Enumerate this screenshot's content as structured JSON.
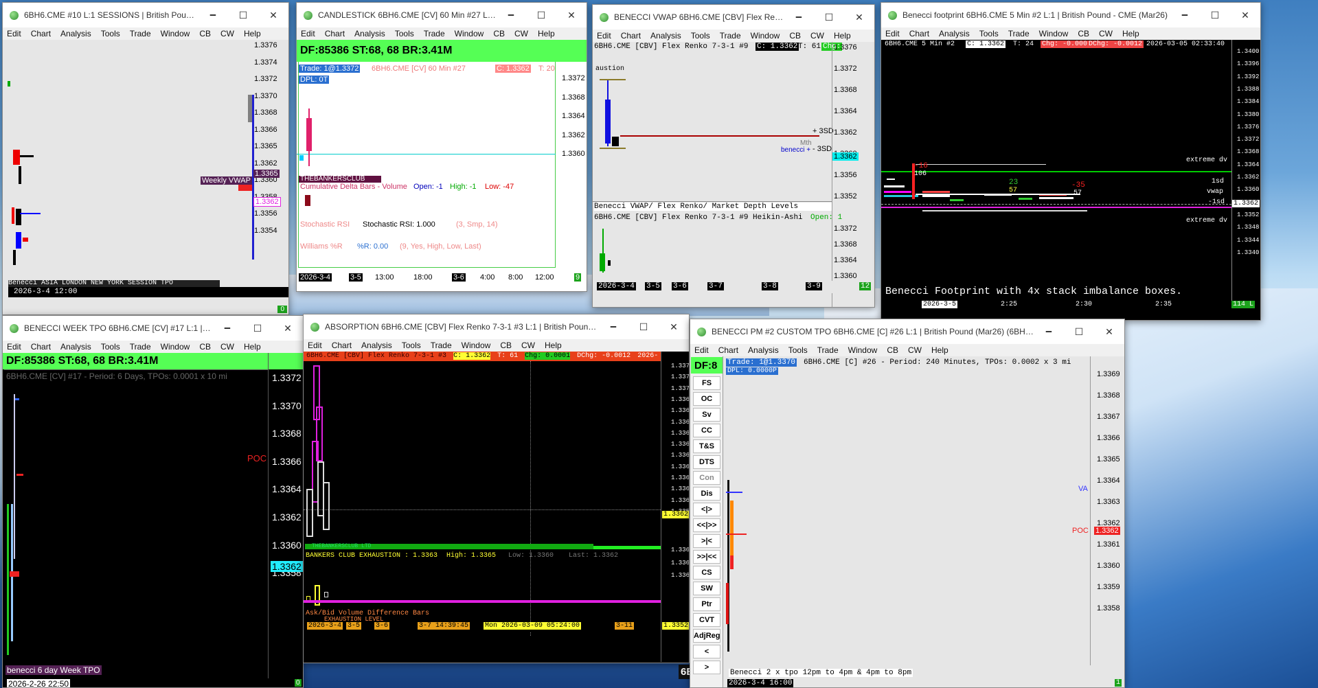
{
  "menu": [
    "Edit",
    "Chart",
    "Analysis",
    "Tools",
    "Trade",
    "Window",
    "CB",
    "CW",
    "Help"
  ],
  "ctrl": {
    "min": "🗕",
    "max": "☐",
    "close": "✕"
  },
  "w1": {
    "title": "6BH6.CME #10 L:1 SESSIONS  | British Pound...",
    "prices": [
      "1.3376",
      "1.3374",
      "1.3372",
      "1.3370",
      "1.3368",
      "1.3366",
      "1.3365",
      "1.3362",
      "1.3360",
      "1.3358",
      "1.3356",
      "1.3354"
    ],
    "wvwap": "Weekly VWAP",
    "bottom": "Benecci ASIA LONDON NEW YORK SESSION TPO",
    "date": "2026-3-4  12:00",
    "badge": "0"
  },
  "w2": {
    "title": "CANDLESTICK 6BH6.CME [CV]  60 Min  #27 L:1 British...",
    "banner": "DF:85386  ST:68, 68  BR:3.41M",
    "trade": "Trade: 1@1.3372",
    "info": "6BH6.CME [CV]  60 Min  #27",
    "close": "C: 1.3362",
    "t": "T: 20",
    "dpl": "DPL: 0T",
    "prices": [
      "1.3372",
      "1.3368",
      "1.3364",
      "1.3362",
      "1.3360"
    ],
    "ind_strip": "THEBANKERSCLUB",
    "cd_label": "Cumulative Delta Bars - Volume",
    "cd_open": "Open: -1",
    "cd_high": "High: -1",
    "cd_low": "Low: -47",
    "st_label": "Stochastic RSI",
    "st_val": "Stochastic RSI: 1.000",
    "st_par": "(3, Smp, 14)",
    "wr_label": "Williams %R",
    "wr_val": "%R: 0.00",
    "wr_par": "(9, Yes, High, Low, Last)",
    "dates": [
      "2026-3-4",
      "3-5",
      "13:00",
      "18:00",
      "3-6",
      "4:00",
      "8:00",
      "12:00"
    ],
    "badge": "9"
  },
  "w3": {
    "title": "BENECCI VWAP 6BH6.CME [CBV]  Flex Renko...",
    "info": "6BH6.CME [CBV]  Flex Renko 7-3-1 #9",
    "close": "C: 1.3362",
    "t": "T: 61",
    "chg": "Chg:",
    "auction": "austion",
    "prices": [
      "1.3376",
      "1.3372",
      "1.3368",
      "1.3364",
      "1.3362",
      "1.3360",
      "1.3356",
      "1.3352"
    ],
    "p3sd": "+ 3SD",
    "m3sd": "- 3SD",
    "mth": "Mth",
    "benecci": "benecci +",
    "footer": "Benecci VWAP/ Flex Renko/ Market Depth Levels",
    "ha": "6BH6.CME [CBV]  Flex Renko 7-3-1 #9 Heikin-Ashi",
    "open": "Open: 1",
    "prices2": [
      "1.3372",
      "1.3368",
      "1.3364",
      "1.3360"
    ],
    "dates": [
      "2026-3-4",
      "3-5",
      "3-6",
      "3-7",
      "3-8",
      "3-9"
    ],
    "badge": "12"
  },
  "w4": {
    "title": "Benecci footprint 6BH6.CME  5 Min  #2 L:1 | British Pound - CME (Mar26)",
    "info": "6BH6.CME  5 Min  #2",
    "close": "C: 1.3362",
    "t": "T: 24",
    "chg": "Chg: -0.0003",
    "dchg": "DChg: -0.0012",
    "dt": "2026-03-05 02:33:40",
    "prices": [
      "1.3400",
      "1.3396",
      "1.3392",
      "1.3388",
      "1.3384",
      "1.3380",
      "1.3376",
      "1.3372",
      "1.3368",
      "1.3364",
      "1.3362",
      "1.3360",
      "1.3356",
      "1.3352",
      "1.3348",
      "1.3344",
      "1.3340"
    ],
    "ext_up": "extreme dv",
    "sd1": "1sd",
    "vwap": "vwap",
    "sdm1": "-1sd",
    "ext_dn": "extreme dv",
    "n16": "-16",
    "n106": "106",
    "n23": "23",
    "n57": "57",
    "n35": "-35",
    "n57b": "57",
    "footer": "Benecci Footprint with 4x stack imbalance boxes.",
    "dates": [
      "2026-3-5",
      "2:25",
      "2:30",
      "2:35"
    ],
    "badge": "114 L"
  },
  "w5": {
    "title": "BENECCI WEEK TPO 6BH6.CME [CV] #17 L:1 | Brit...",
    "banner": "DF:85386  ST:68, 68  BR:3.41M",
    "info": "6BH6.CME [CV] #17 - Period: 6 Days, TPOs: 0.0001 x 10 mi",
    "prices": [
      "1.3372",
      "1.3370",
      "1.3368",
      "1.3366",
      "1.3364",
      "1.3362",
      "1.3360",
      "1.3358"
    ],
    "poc": "POC",
    "footer": "benecci 6 day Week TPO",
    "date": "2026-2-26  22:50",
    "badge": "0"
  },
  "w6": {
    "title": "ABSORPTION  6BH6.CME [CBV]  Flex Renko 7-3-1 #3 L:1 | British Pound (...",
    "info": "6BH6.CME [CBV]  Flex Renko 7-3-1 #3",
    "close": "C: 1.3362",
    "t": "T: 61",
    "chg": "Chg: 0.0001",
    "dchg": "DChg: -0.0012",
    "yr": "2026-",
    "prices": [
      "1.3372",
      "1.3371",
      "1.3370",
      "1.3369",
      "1.3368",
      "1.3367",
      "1.3366",
      "1.3365",
      "1.3364",
      "1.3363",
      "1.3362",
      "1.3361",
      "1.3360",
      "1.3359"
    ],
    "strip": "THEBANKERSCLUB LTD",
    "bce": "BANKERS CLUB EXHAUSTION : 1.3363",
    "bce_h": "High: 1.3365",
    "bce_l": "Low: 1.3360",
    "bce_last": "Last: 1.3362",
    "prices2": [
      "1.3368",
      "1.3364",
      "1.3360"
    ],
    "abd": "Ask/Bid Volume Difference Bars",
    "exh": "EXHAUSTION LEVEL",
    "dates": [
      "2026-3-4",
      "3-5",
      "3-6",
      "3-7  14:39:45",
      "Mon 2026-03-09  05:24:00",
      "3-11"
    ],
    "xp": "1.3352"
  },
  "w7": {
    "title": "BENECCI PM #2 CUSTOM TPO 6BH6.CME [C] #26 L:1 | British Pound (Mar26) (6BH6.C...",
    "df": "DF:8",
    "trade": "Trade: 1@1.3370",
    "dpl": "DPL: 0.0000P",
    "info": "6BH6.CME [C] #26 - Period: 240 Minutes, TPOs: 0.0002 x 3 mi",
    "side": [
      "FS",
      "OC",
      "Sv",
      "CC",
      "T&S",
      "DTS",
      "Con",
      "Dis",
      "<|>",
      "<<|>>",
      ">|<",
      ">>|<<",
      "CS",
      "SW",
      "Ptr",
      "CVT",
      "AdjReg",
      "<",
      ">"
    ],
    "prices": [
      "1.3369",
      "1.3368",
      "1.3367",
      "1.3366",
      "1.3365",
      "1.3364",
      "1.3363",
      "1.3362",
      "1.3361",
      "1.3360",
      "1.3359",
      "1.3358"
    ],
    "va": "VA",
    "poc": "POC",
    "footer": "Benecci 2 x tpo 12pm to 4pm & 4pm to 8pm",
    "date": "2026-3-4  16:00",
    "badge": "1"
  },
  "behind": "6E"
}
